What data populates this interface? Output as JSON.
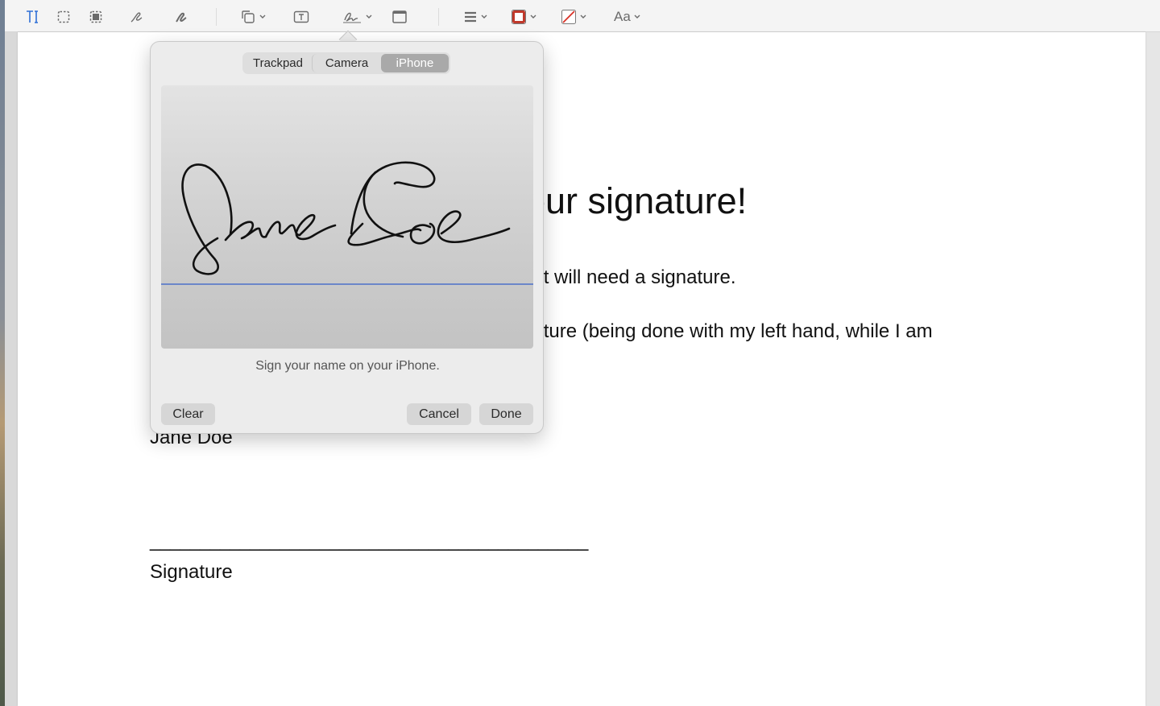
{
  "toolbar": {
    "tools": [
      "text-select-icon",
      "rect-select-icon",
      "smart-lasso-icon",
      "sketch-icon",
      "draw-icon",
      "shapes-icon",
      "text-box-icon",
      "sign-icon",
      "note-icon",
      "shape-style-icon",
      "border-color-icon",
      "fill-color-icon",
      "text-style-icon"
    ],
    "text_style_label": "Aa",
    "accent": "#2f6fd6"
  },
  "document": {
    "heading": "our signature!",
    "line1": "hat will need a signature.",
    "line2": "nature (being done with my left hand, while I am",
    "name": "Jane Doe",
    "rule": "____________________________________________",
    "signature_label": "Signature"
  },
  "signature_popover": {
    "tabs": [
      {
        "label": "Trackpad",
        "selected": false
      },
      {
        "label": "Camera",
        "selected": false
      },
      {
        "label": "iPhone",
        "selected": true
      }
    ],
    "hint": "Sign your name on your iPhone.",
    "clear_label": "Clear",
    "cancel_label": "Cancel",
    "done_label": "Done",
    "baseline_color": "#6b86c9"
  }
}
